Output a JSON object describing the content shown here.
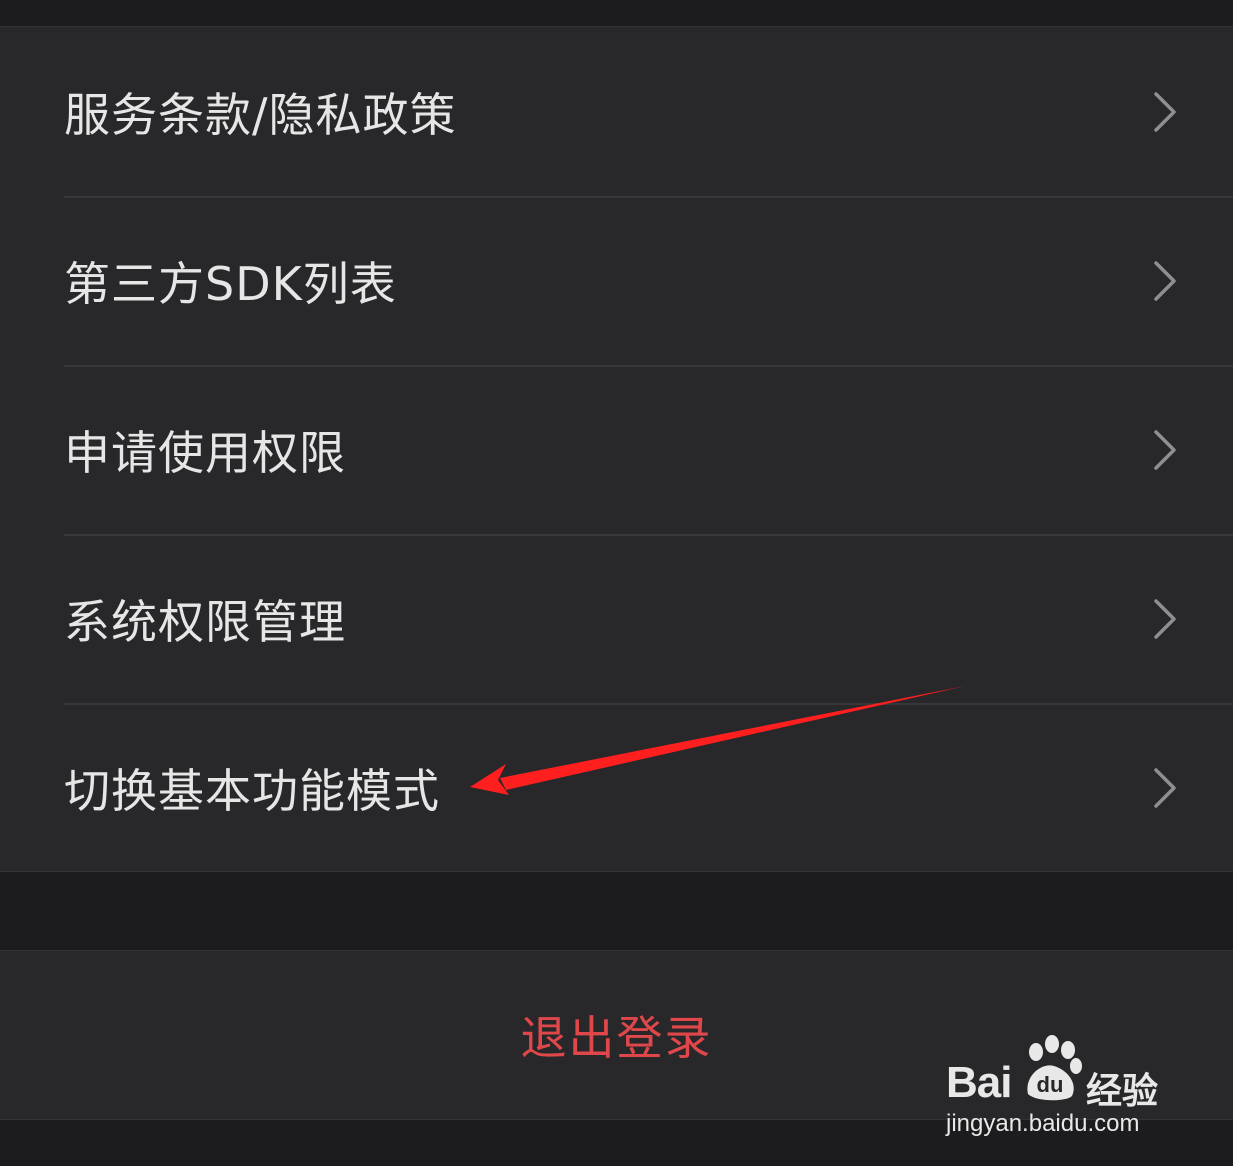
{
  "settings": {
    "items": [
      {
        "label": "服务条款/隐私政策",
        "icon": "chevron-right-icon"
      },
      {
        "label": "第三方SDK列表",
        "icon": "chevron-right-icon"
      },
      {
        "label": "申请使用权限",
        "icon": "chevron-right-icon"
      },
      {
        "label": "系统权限管理",
        "icon": "chevron-right-icon"
      },
      {
        "label": "切换基本功能模式",
        "icon": "chevron-right-icon"
      }
    ]
  },
  "logout": {
    "label": "退出登录",
    "color": "#e0474a"
  },
  "annotation": {
    "icon": "red-arrow",
    "color": "#ff1f1f"
  },
  "watermark": {
    "brand": "Bai",
    "brand_suffix": "du",
    "cn": "经验",
    "url": "jingyan.baidu.com"
  },
  "colors": {
    "background": "#1c1c1e",
    "panel": "#28282b",
    "text": "#e6e6e6",
    "chevron": "#8e8e93"
  }
}
